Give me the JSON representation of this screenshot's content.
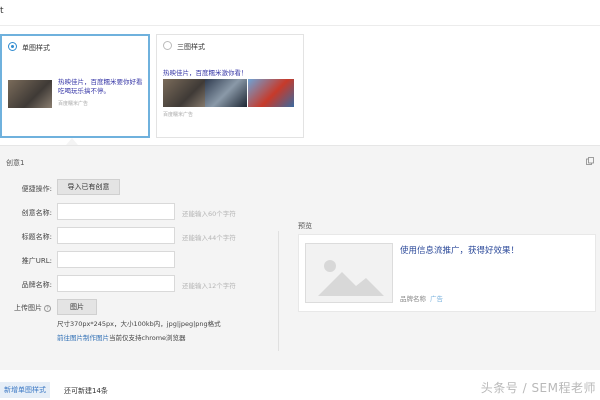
{
  "header": {
    "fragment": "t"
  },
  "style_options": {
    "single": {
      "label": "单图样式",
      "ad_text": "热映佳片，百度糯米要你好看 吃喝玩乐搞不停。",
      "meta_site": "百度糯米",
      "meta_ad": "广告"
    },
    "triple": {
      "label": "三图样式",
      "ad_text": "热映佳片，百度糯米激你看！",
      "meta_site": "百度糯米",
      "meta_ad": "广告"
    }
  },
  "creative": {
    "title": "创意1",
    "quick_action_label": "便捷操作:",
    "import_button": "导入已有创意",
    "fields": [
      {
        "label": "创意名称:",
        "value": "",
        "hint": "还能输入60个字符"
      },
      {
        "label": "标题名称:",
        "value": "",
        "hint": "还能输入44个字符"
      },
      {
        "label": "推广URL:",
        "value": "",
        "hint": ""
      },
      {
        "label": "品牌名称:",
        "value": "",
        "hint": "还能输入12个字符"
      }
    ],
    "upload_label": "上传图片",
    "upload_button": "图片",
    "size_note": "尺寸370px*245px，大小100kb内，jpg|jpeg|png格式",
    "link_text": "前往图片制作图片",
    "link_suffix": "当前仅支持chrome浏览器"
  },
  "preview": {
    "label": "预览",
    "headline": "使用信息流推广，获得好效果！",
    "brand": "品牌名称",
    "ad": "广告"
  },
  "footer": {
    "add_button": "新增单图样式",
    "remaining": "还可新建14条",
    "watermark": "头条号 / SEM程老师"
  },
  "colors": {
    "accent": "#2f8bd0",
    "panel_bg": "#f4f4f4",
    "headline": "#2c4a9a"
  }
}
